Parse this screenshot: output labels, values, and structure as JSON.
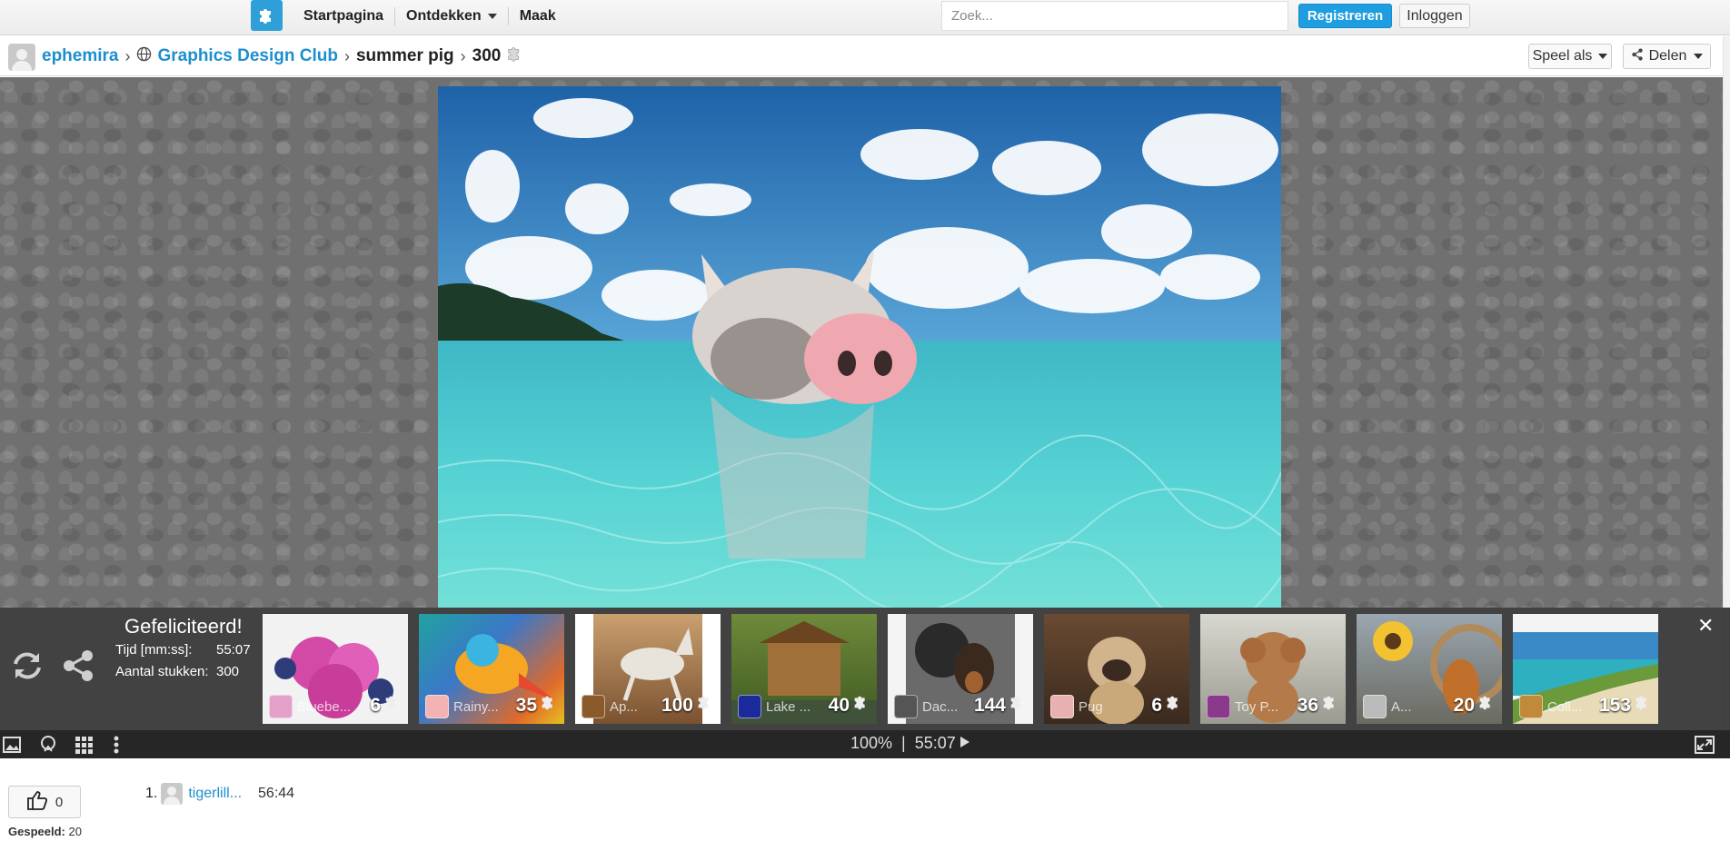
{
  "nav": {
    "home": "Startpagina",
    "discover": "Ontdekken",
    "create": "Maak",
    "search_placeholder": "Zoek...",
    "register": "Registreren",
    "login": "Inloggen"
  },
  "breadcrumb": {
    "user": "ephemira",
    "club": "Graphics Design Club",
    "puzzle": "summer pig",
    "pieces": "300",
    "play_as": "Speel als",
    "share": "Delen"
  },
  "result": {
    "title": "Gefeliciteerd!",
    "time_label": "Tijd [mm:ss]:",
    "time_value": "55:07",
    "pieces_label": "Aantal stukken:",
    "pieces_value": "300"
  },
  "suggestions": [
    {
      "label": "Bluebe...",
      "pieces": "6"
    },
    {
      "label": "Rainy...",
      "pieces": "35"
    },
    {
      "label": "Ap...",
      "pieces": "100"
    },
    {
      "label": "Lake ...",
      "pieces": "40"
    },
    {
      "label": "Dac...",
      "pieces": "144"
    },
    {
      "label": "Pug",
      "pieces": "6"
    },
    {
      "label": "Toy P...",
      "pieces": "36"
    },
    {
      "label": "A...",
      "pieces": "20"
    },
    {
      "label": "Coll...",
      "pieces": "153"
    }
  ],
  "toolbar": {
    "zoom": "100%",
    "separator": "|",
    "timer": "55:07"
  },
  "stats": {
    "likes": "0",
    "played_label": "Gespeeld:",
    "played_value": "20"
  },
  "scores": [
    {
      "rank": "1.",
      "name": "tigerlill...",
      "time": "56:44"
    }
  ],
  "colors": {
    "accent": "#1e9de0",
    "link": "#1c8fd0",
    "panel": "#282828"
  }
}
